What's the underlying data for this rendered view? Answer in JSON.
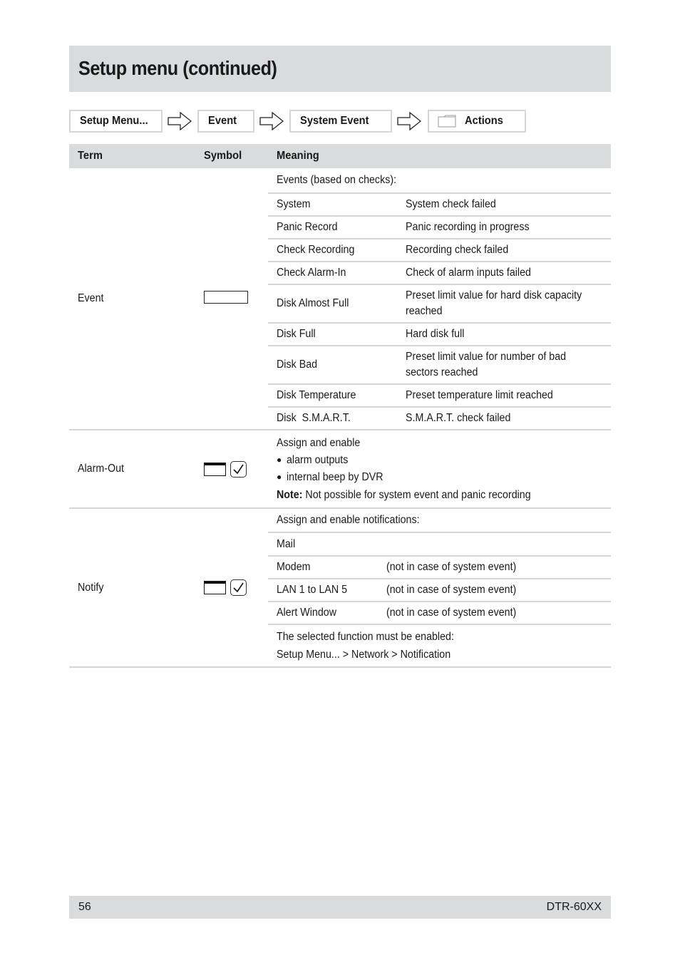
{
  "page": {
    "title": "Setup menu (continued)",
    "footer": {
      "page_number": "56",
      "model": "DTR-60XX"
    }
  },
  "breadcrumb": [
    {
      "label": "Setup Menu...",
      "icon": null
    },
    {
      "label": "Event",
      "icon": null
    },
    {
      "label": "System Event",
      "icon": null
    },
    {
      "label": "Actions",
      "icon": "folder-icon"
    }
  ],
  "table": {
    "headers": {
      "term": "Term",
      "symbol": "Symbol",
      "meaning": "Meaning"
    },
    "rows": [
      {
        "term": "Event",
        "symbol": "input-field",
        "intro": "Events (based on checks):",
        "items": [
          {
            "name": "System",
            "desc": "System check failed"
          },
          {
            "name": "Panic Record",
            "desc": "Panic recording in progress"
          },
          {
            "name": "Check Recording",
            "desc": "Recording check failed"
          },
          {
            "name": "Check Alarm-In",
            "desc": "Check of alarm inputs failed"
          },
          {
            "name": "Disk Almost Full",
            "desc": "Preset limit value for hard disk capacity reached"
          },
          {
            "name": "Disk Full",
            "desc": "Hard disk full"
          },
          {
            "name": "Disk Bad",
            "desc": "Preset limit value for number of bad sectors reached"
          },
          {
            "name": "Disk Temperature",
            "desc": "Preset temperature limit reached"
          },
          {
            "name": "Disk  S.M.A.R.T.",
            "desc": "S.M.A.R.T. check failed"
          }
        ]
      },
      {
        "term": "Alarm-Out",
        "symbol": "window-and-checkbox",
        "intro": "Assign and enable",
        "bullets": [
          "alarm outputs",
          "internal beep by DVR"
        ],
        "note_label": "Note:",
        "note_text": " Not possible for system event and panic recording"
      },
      {
        "term": "Notify",
        "symbol": "window-and-checkbox",
        "intro": "Assign and enable notifications:",
        "items": [
          {
            "name": "Mail",
            "desc": ""
          },
          {
            "name": "Modem",
            "desc": "(not in case of system event)"
          },
          {
            "name": "LAN 1 to LAN 5",
            "desc": "(not in case of system event)"
          },
          {
            "name": "Alert Window",
            "desc": "(not in case of system event)"
          }
        ],
        "footer_line1": "The selected function must be enabled:",
        "footer_line2": "Setup Menu... > Network > Notification"
      }
    ]
  }
}
